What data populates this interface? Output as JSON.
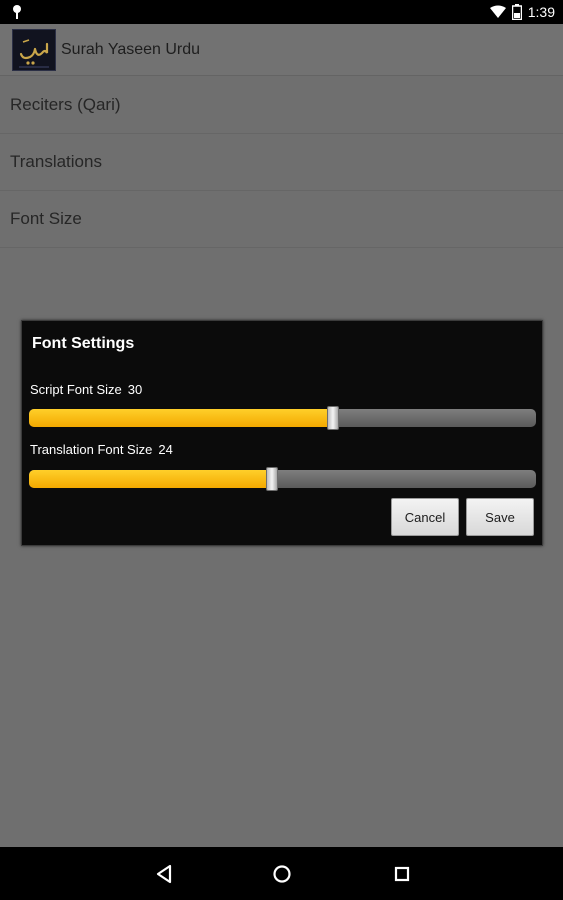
{
  "status_bar": {
    "time": "1:39",
    "notification_icon": "map-pin-icon",
    "wifi_icon": "wifi-icon",
    "battery_icon": "battery-icon"
  },
  "app": {
    "title": "Surah Yaseen Urdu",
    "logo_icon": "yaseen-calligraphy-logo"
  },
  "preferences": [
    {
      "label": "Reciters (Qari)"
    },
    {
      "label": "Translations"
    },
    {
      "label": "Font Size"
    }
  ],
  "dialog": {
    "title": "Font Settings",
    "script_font": {
      "label": "Script Font Size",
      "value": "30",
      "fraction": 0.6
    },
    "translation_font": {
      "label": "Translation Font Size",
      "value": "24",
      "fraction": 0.48
    },
    "cancel_label": "Cancel",
    "save_label": "Save"
  },
  "nav_bar": {
    "back_icon": "back-triangle-icon",
    "home_icon": "home-circle-icon",
    "recents_icon": "recents-square-icon"
  },
  "colors": {
    "slider_fill": "#f5b400",
    "dialog_background": "#0b0b0b",
    "overlay": "#6f6f6f"
  }
}
